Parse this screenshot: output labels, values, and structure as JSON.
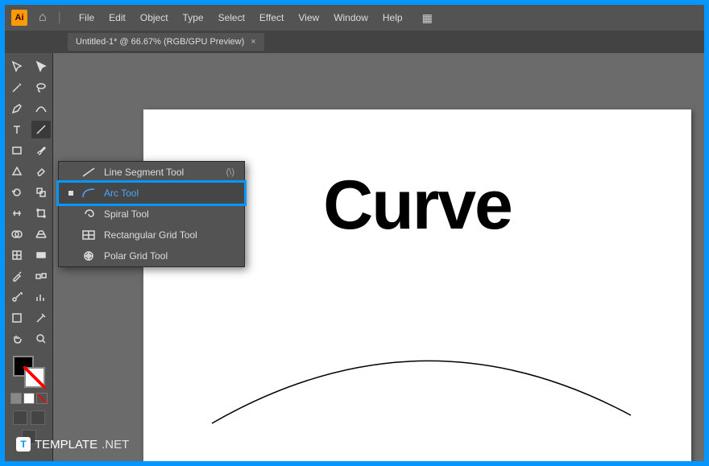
{
  "titlebar": {
    "logo": "Ai"
  },
  "menu": {
    "items": [
      "File",
      "Edit",
      "Object",
      "Type",
      "Select",
      "Effect",
      "View",
      "Window",
      "Help"
    ]
  },
  "tab": {
    "label": "Untitled-1* @ 66.67% (RGB/GPU Preview)",
    "close": "×"
  },
  "flyout": {
    "items": [
      {
        "label": "Line Segment Tool",
        "shortcut": "(\\)",
        "sel": false
      },
      {
        "label": "Arc Tool",
        "shortcut": "",
        "sel": true
      },
      {
        "label": "Spiral Tool",
        "shortcut": "",
        "sel": false
      },
      {
        "label": "Rectangular Grid Tool",
        "shortcut": "",
        "sel": false
      },
      {
        "label": "Polar Grid Tool",
        "shortcut": "",
        "sel": false
      }
    ]
  },
  "canvas": {
    "text": "Curve"
  },
  "watermark": {
    "brand": "TEMPLATE",
    "suffix": ".NET"
  }
}
